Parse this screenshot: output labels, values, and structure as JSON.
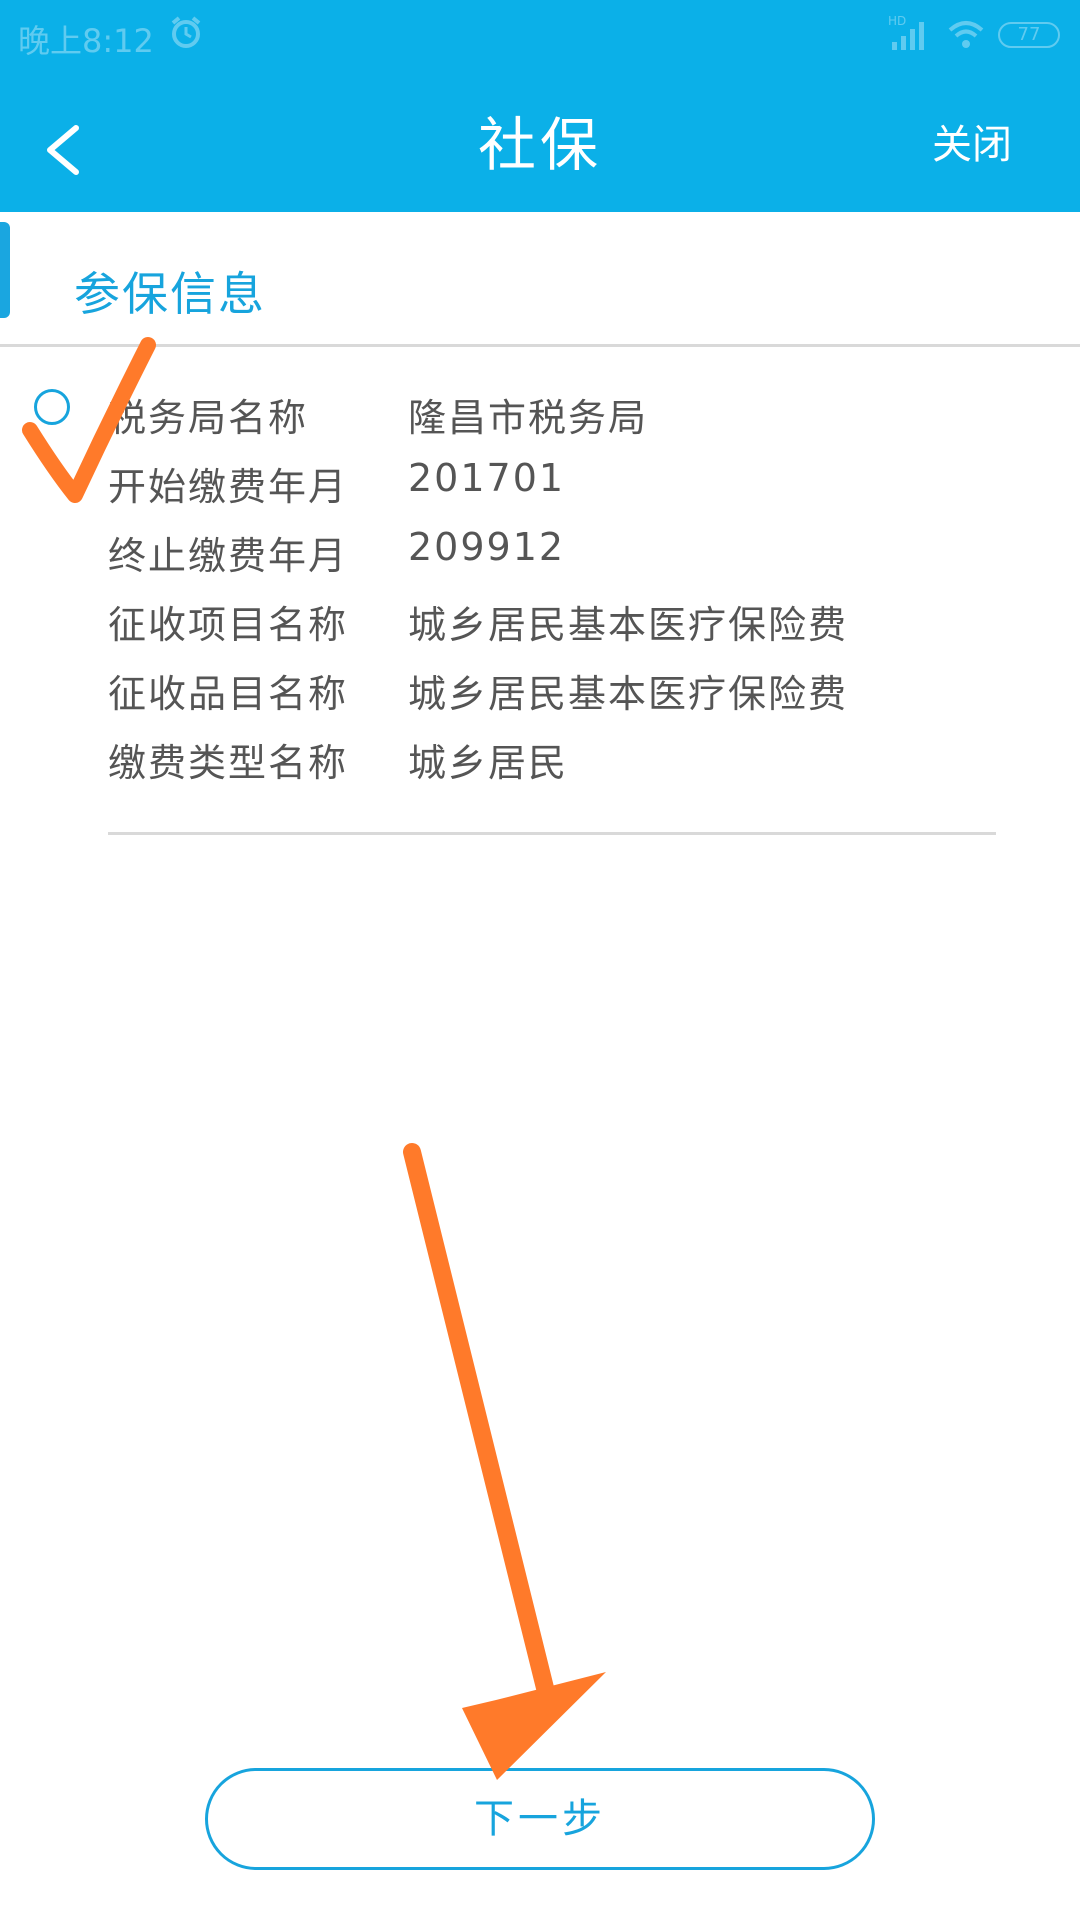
{
  "status_bar": {
    "time": "晚上8:12",
    "battery": "77",
    "network_badge": "HD"
  },
  "nav": {
    "title": "社保",
    "close_label": "关闭"
  },
  "section": {
    "title": "参保信息"
  },
  "record": {
    "rows": [
      {
        "label": "税务局名称",
        "value": "隆昌市税务局"
      },
      {
        "label": "开始缴费年月",
        "value": "201701"
      },
      {
        "label": "终止缴费年月",
        "value": "209912"
      },
      {
        "label": "征收项目名称",
        "value": "城乡居民基本医疗保险费"
      },
      {
        "label": "征收品目名称",
        "value": "城乡居民基本医疗保险费"
      },
      {
        "label": "缴费类型名称",
        "value": "城乡居民"
      }
    ]
  },
  "footer": {
    "next_label": "下一步"
  },
  "colors": {
    "primary": "#0bb0e8",
    "accent": "#17a4dd",
    "annotation": "#ff7a2a"
  }
}
